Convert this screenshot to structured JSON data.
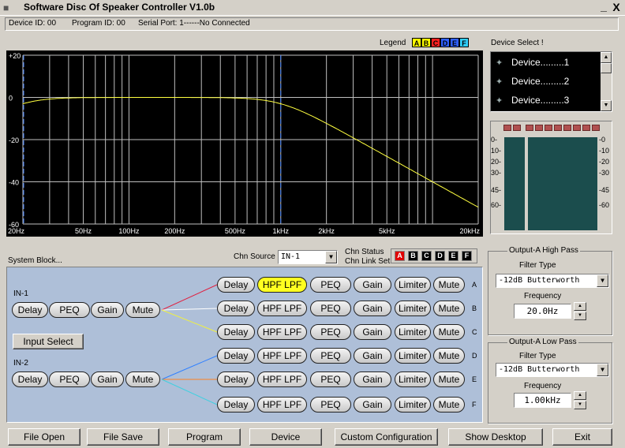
{
  "window": {
    "title": "Software Disc Of Speaker Controller V1.0b",
    "min_glyph": "_",
    "close_glyph": "X"
  },
  "status": {
    "device_id": "Device ID: 00",
    "program_id": "Program ID: 00",
    "serial_port": "Serial Port: 1------No Connected"
  },
  "legend": {
    "label": "Legend",
    "items": [
      "A",
      "B",
      "C",
      "D",
      "E",
      "F"
    ],
    "colors": [
      "#ffff00",
      "#ffff00",
      "#ff2020",
      "#3060ff",
      "#3060ff",
      "#30d0ff"
    ]
  },
  "graph": {
    "y_ticks": [
      "+20",
      "0",
      "-20",
      "-40",
      "-60"
    ],
    "x_ticks": [
      "20Hz",
      "50Hz",
      "100Hz",
      "200Hz",
      "500Hz",
      "1kHz",
      "2kHz",
      "5kHz",
      "20kHz"
    ],
    "curve_color": "#ffff40"
  },
  "device_select": {
    "label": "Device Select !",
    "items": [
      "Device.........1",
      "Device.........2",
      "Device.........3"
    ]
  },
  "meters": {
    "left_ticks": [
      "0-",
      "10-",
      "20-",
      "30-",
      "45-",
      "60-"
    ],
    "right_ticks": [
      "-0",
      "-10",
      "-20",
      "-30",
      "-45",
      "-60"
    ]
  },
  "system_block": {
    "label": "System Block...",
    "chn_source_label": "Chn Source",
    "chn_source_value": "IN-1",
    "chn_status_label": "Chn Status",
    "chn_link_label": "Chn Link Set",
    "channels": [
      "A",
      "B",
      "C",
      "D",
      "E",
      "F"
    ],
    "active_channel": "A",
    "in1_label": "IN-1",
    "in2_label": "IN-2",
    "input_select_label": "Input Select",
    "input_chain": [
      "Delay",
      "PEQ",
      "Gain",
      "Mute"
    ],
    "output_chain": [
      "Delay",
      "HPF LPF",
      "PEQ",
      "Gain",
      "Limiter",
      "Mute"
    ],
    "output_letters": [
      "A",
      "B",
      "C",
      "D",
      "E",
      "F"
    ],
    "line_colors": [
      "#e02040",
      "#ffffff",
      "#f0f040",
      "#3080ff",
      "#ff8020",
      "#40d0e0"
    ]
  },
  "output_hp": {
    "title": "Output-A High Pass",
    "filter_type_label": "Filter Type",
    "filter_type": "-12dB Butterworth",
    "frequency_label": "Frequency",
    "frequency": "20.0Hz"
  },
  "output_lp": {
    "title": "Output-A Low  Pass",
    "filter_type_label": "Filter Type",
    "filter_type": "-12dB Butterworth",
    "frequency_label": "Frequency",
    "frequency": "1.00kHz"
  },
  "buttons": {
    "file_open": "File Open",
    "file_save": "File Save",
    "program": "Program",
    "device": "Device",
    "custom_config": "Custom Configuration",
    "show_desktop": "Show Desktop",
    "exit": "Exit"
  }
}
